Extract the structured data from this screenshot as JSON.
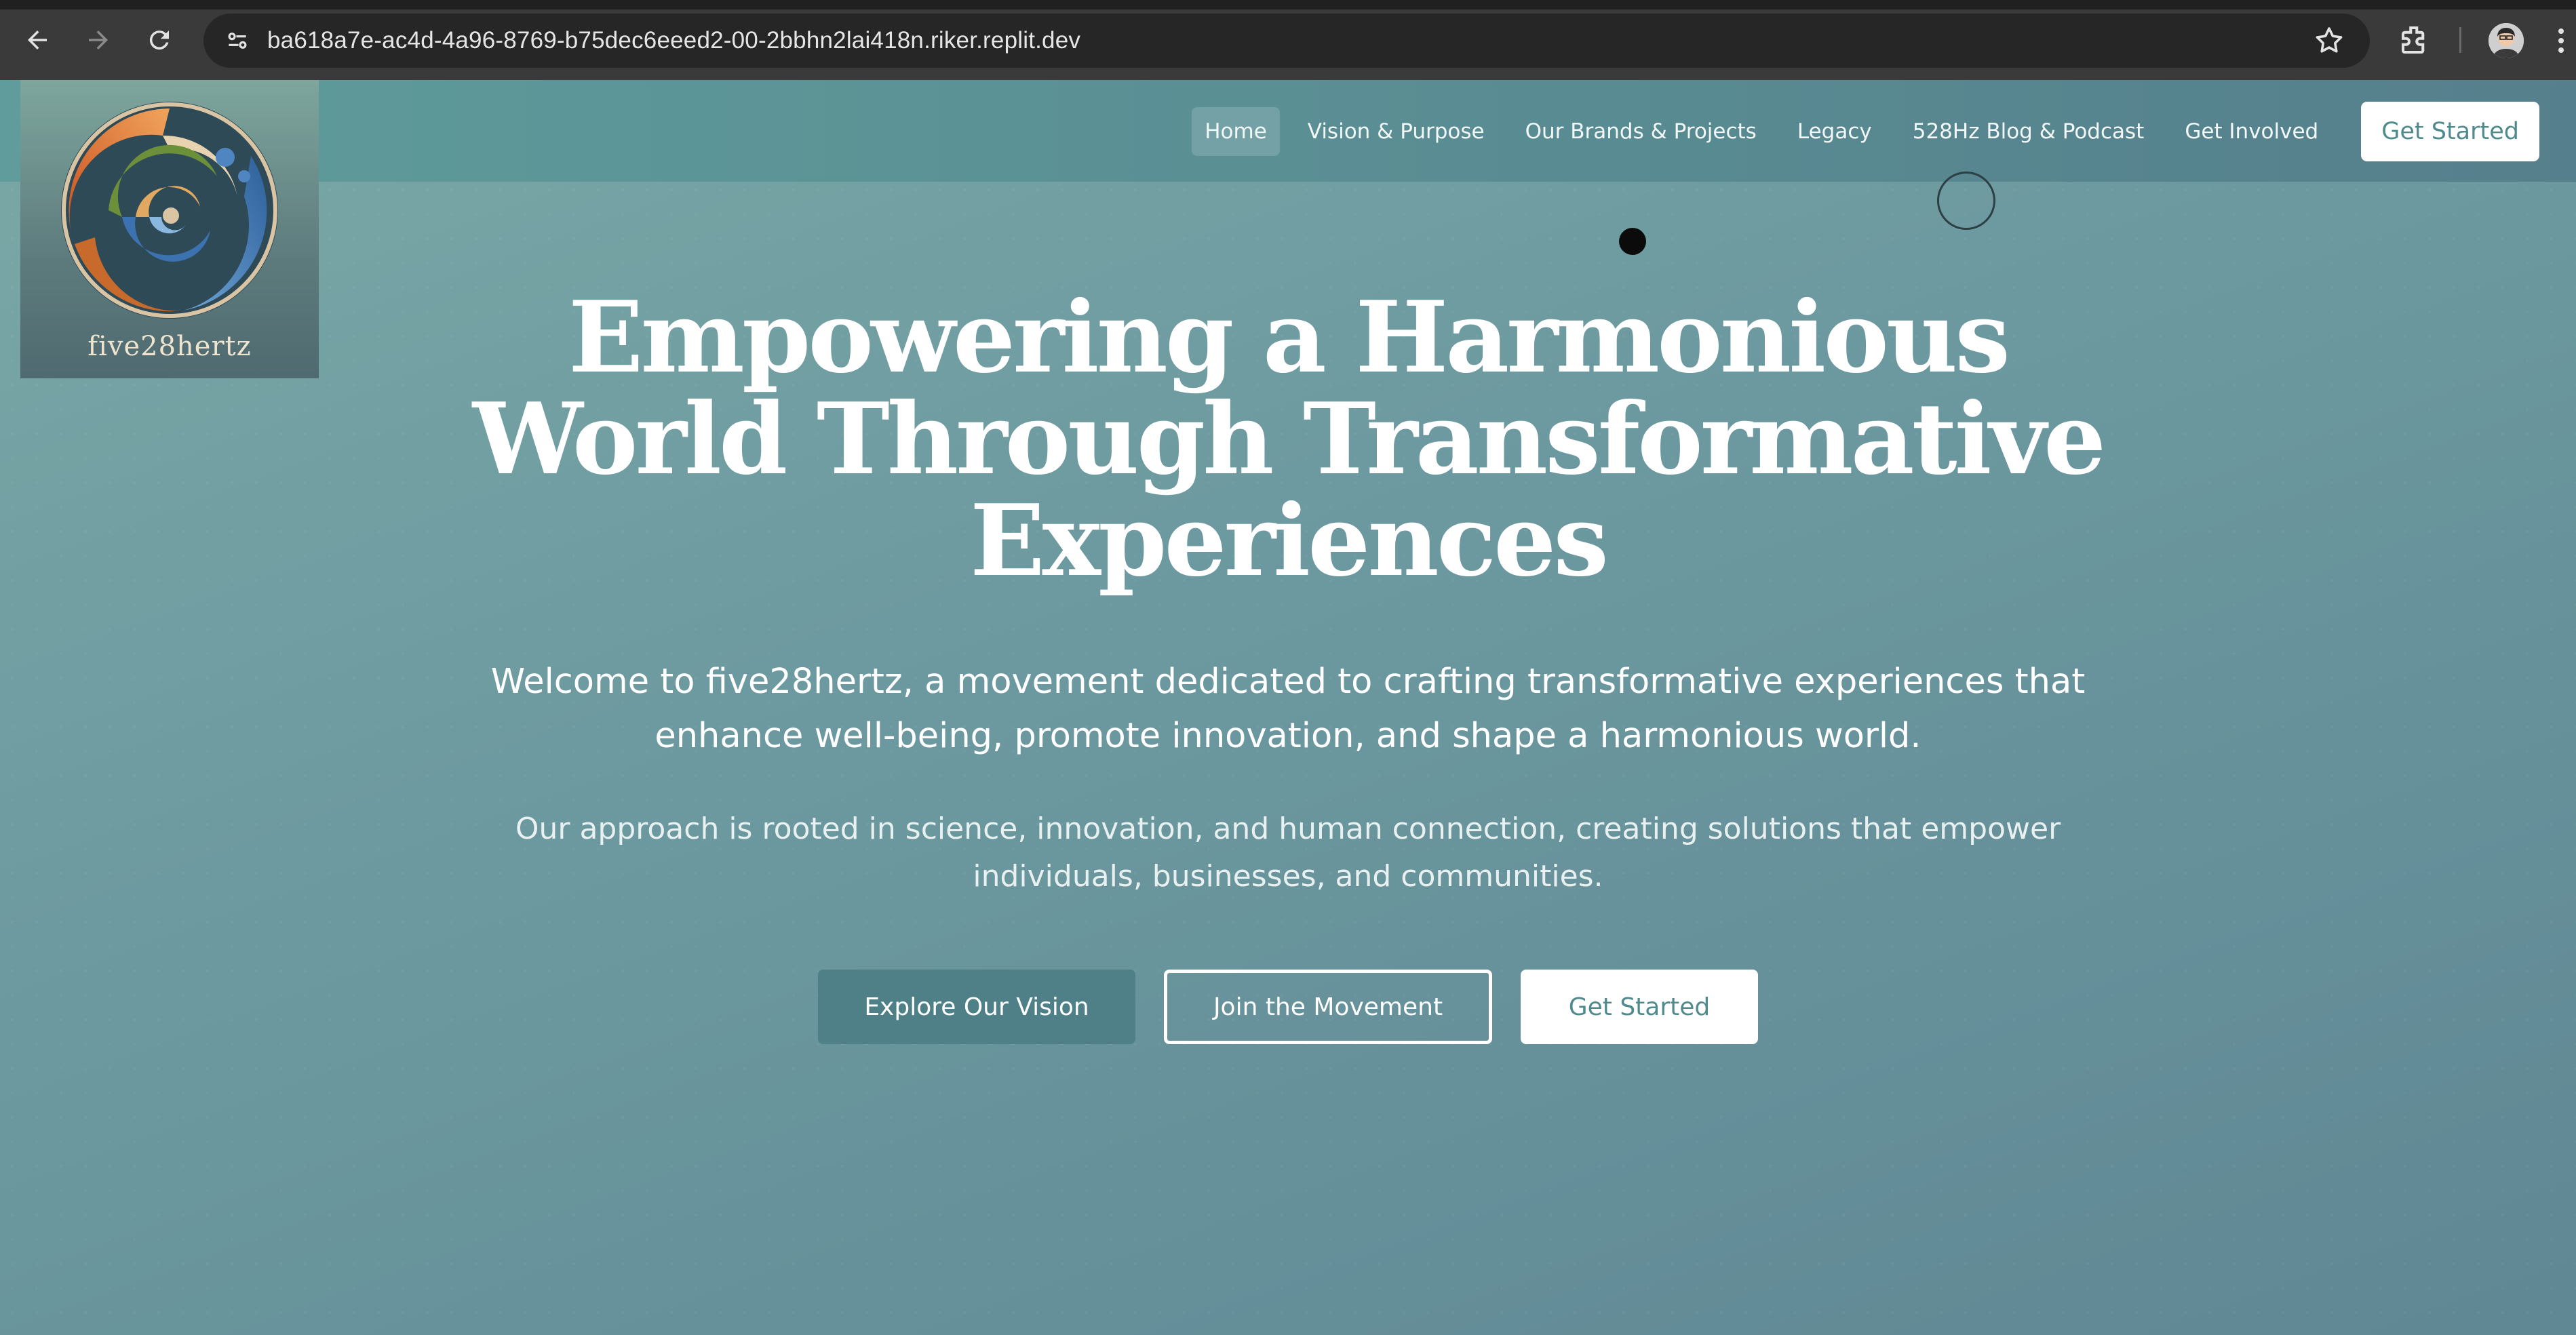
{
  "browser": {
    "url": "ba618a7e-ac4d-4a96-8769-b75dec6eeed2-00-2bbhn2lai418n.riker.replit.dev",
    "icons": [
      "back-arrow-icon",
      "forward-arrow-icon",
      "reload-icon",
      "site-settings-icon",
      "bookmark-star-icon",
      "extensions-icon",
      "profile-avatar",
      "kebab-menu-icon"
    ]
  },
  "site": {
    "logo_text": "five28hertz",
    "nav": {
      "items": [
        {
          "label": "Home",
          "active": true
        },
        {
          "label": "Vision & Purpose",
          "active": false
        },
        {
          "label": "Our Brands & Projects",
          "active": false
        },
        {
          "label": "Legacy",
          "active": false
        },
        {
          "label": "528Hz Blog & Podcast",
          "active": false
        },
        {
          "label": "Get Involved",
          "active": false
        }
      ],
      "cta_label": "Get Started"
    },
    "hero": {
      "title_lines": [
        "Empowering a Harmonious",
        "World Through Transformative",
        "Experiences"
      ],
      "lead_lines": [
        "Welcome to five28hertz, a movement dedicated to crafting transformative experiences that",
        "enhance well-being, promote innovation, and shape a harmonious world."
      ],
      "sub_lines": [
        "Our approach is rooted in science, innovation, and human connection, creating solutions that empower",
        "individuals, businesses, and communities."
      ],
      "buttons": {
        "explore": "Explore Our Vision",
        "join": "Join the Movement",
        "start": "Get Started"
      }
    },
    "colors": {
      "accent": "#4f8087",
      "cta_text": "#4f8b8c",
      "nav_bg": "#5a8f94"
    }
  }
}
